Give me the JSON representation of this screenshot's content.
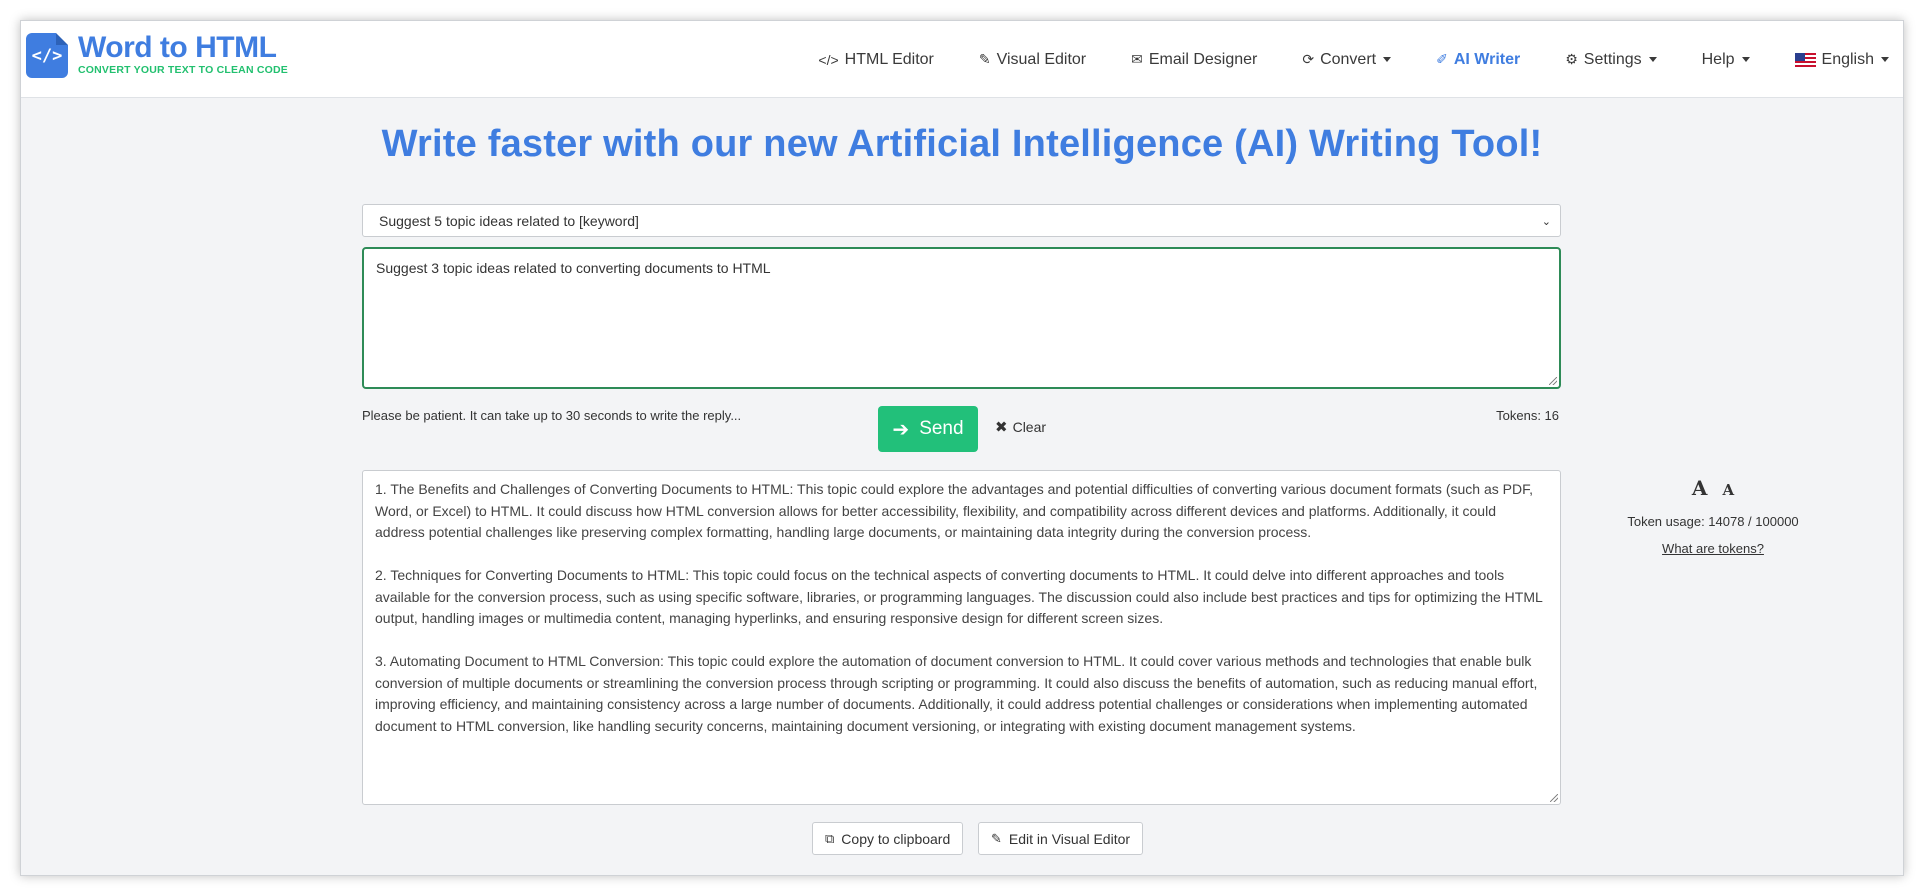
{
  "brand": {
    "title": "Word to HTML",
    "subtitle": "CONVERT YOUR TEXT TO CLEAN CODE",
    "badge_text": "</>",
    "accent": "#3f7de0",
    "sub_color": "#22c06f"
  },
  "nav": {
    "html_editor": "HTML Editor",
    "visual_editor": "Visual Editor",
    "email_designer": "Email Designer",
    "convert": "Convert",
    "ai_writer": "AI Writer",
    "settings": "Settings",
    "help": "Help",
    "language": "English"
  },
  "heading": "Write faster with our new Artificial Intelligence (AI) Writing Tool!",
  "template_select": {
    "selected": "Suggest 5 topic ideas related to [keyword]"
  },
  "prompt": {
    "value": "Suggest 3 topic ideas related to converting documents to HTML"
  },
  "patience_note": "Please be patient. It can take up to 30 seconds to write the reply...",
  "send_label": "Send",
  "clear_label": "Clear",
  "tokens_label": "Tokens: 16",
  "output": {
    "paragraphs": [
      "1. The Benefits and Challenges of Converting Documents to HTML: This topic could explore the advantages and potential difficulties of converting various document formats (such as PDF, Word, or Excel) to HTML. It could discuss how HTML conversion allows for better accessibility, flexibility, and compatibility across different devices and platforms. Additionally, it could address potential challenges like preserving complex formatting, handling large documents, or maintaining data integrity during the conversion process.",
      "2. Techniques for Converting Documents to HTML: This topic could focus on the technical aspects of converting documents to HTML. It could delve into different approaches and tools available for the conversion process, such as using specific software, libraries, or programming languages. The discussion could also include best practices and tips for optimizing the HTML output, handling images or multimedia content, managing hyperlinks, and ensuring responsive design for different screen sizes.",
      "3. Automating Document to HTML Conversion: This topic could explore the automation of document conversion to HTML. It could cover various methods and technologies that enable bulk conversion of multiple documents or streamlining the conversion process through scripting or programming. It could also discuss the benefits of automation, such as reducing manual effort, improving efficiency, and maintaining consistency across a large number of documents. Additionally, it could address potential challenges or considerations when implementing automated document to HTML conversion, like handling security concerns, maintaining document versioning, or integrating with existing document management systems."
    ]
  },
  "side": {
    "font_big": "A",
    "font_small": "A",
    "token_usage": "Token usage: 14078 / 100000",
    "what_tokens": "What are tokens?"
  },
  "buttons": {
    "copy": "Copy to clipboard",
    "edit_visual": "Edit in Visual Editor"
  }
}
